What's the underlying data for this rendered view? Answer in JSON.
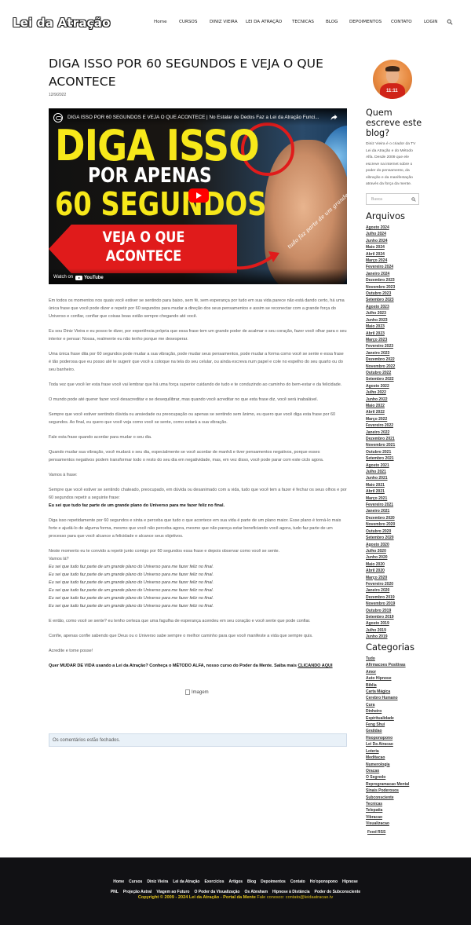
{
  "header": {
    "logo": "Lei da Atração",
    "nav": [
      "Home",
      "CURSOS",
      "DINIZ VIEIRA",
      "LEI DA ATRAÇÃO",
      "TECNICAS",
      "BLOG",
      "DEPOIMENTOS",
      "CONTATO",
      "LOGIN"
    ]
  },
  "post": {
    "title": "DIGA ISSO POR 60 SEGUNDOS E VEJA O QUE ACONTECE",
    "date": "12/9/2022"
  },
  "video": {
    "title": "DIGA ISSO POR 60 SEGUNDOS E VEJA O QUE ACONTECE | No Estalar de Dedos Faz a Lei da Atração Funci...",
    "line1": "DIGA ISSO",
    "line2": "POR APENAS",
    "line3": "60 SEGUNDOS",
    "banner": "VEJA O QUE ACONTECE",
    "hand_text": "tudo faz parte de um grande plano",
    "watch_on": "Watch on",
    "youtube": "YouTube"
  },
  "article": {
    "p1": "Em todos os momentos nos quais você estiver se sentindo para baixo, sem fé, sem esperança por tudo em sua vida parece não está dando certo, há uma única frase que você pode dizer e repetir por 60 segundos para mudar a direção dos seus pensamentos e assim se reconectar com a grande força do Universo e confiar, confiar que coisas boas estão sempre chegando até você.",
    "p2": "Eu sou Diniz Vieira e eu posso te dizer, por experiência própria que essa frase tem um grande poder de acalmar o seu coração, fazer você olhar para o seu interior e pensar: Nossa, realmente eu não tenho porque me desesperar.",
    "p3": "Uma única frase dita por 60 segundos pode mudar a sua vibração, pode mudar seus pensamentos, pode mudar a forma como você se sente e essa frase é tão poderosa que eu posso até te sugerir que você a coloque na tela do seu celular, ou ainda escreva num papel e cole no espelho do seu quarto ou do seu banheiro.",
    "p4": "Toda vez que você ler esta frase você vai lembrar que há uma força superior cuidando de tudo e te conduzindo ao caminho do bem-estar e da felicidade.",
    "p5": "O mundo pode até querer fazer você desacreditar e se desequilibrar, mas quando você acreditar no que esta frase diz, você será inabalável.",
    "p6": "Sempre que você estiver sentindo dúvida ou ansiedade ou preocupação ou apenas se sentindo sem ânimo, eu quero que você diga esta frase por 60 segundos. Ao final, eu quero que você veja como você se sente, como estará a sua vibração.",
    "p7": "Fale esta frase quando acordar para mudar o seu dia.",
    "p8": "Quando mudar sua vibração, você mudará o seu dia, especialmente se você acordar de manhã e tiver pensamentos negativos, porque esses pensamentos negativos podem transformar todo o resto do seu dia em negatividade, mas, em vez disso, você pode parar com este ciclo agora.",
    "p9": "Vamos à frase:",
    "p10": "Sempre que você estiver se sentindo chateado, preocupado, em dúvida ou desanimado com a vida, tudo que você tem a fazer é fechar os seus olhos e por 60 segundos repetir a seguinte frase:",
    "phrase": "Eu sei que tudo faz parte de um grande plano do Universo para me fazer feliz no final.",
    "p11": "Diga isso repetidamente por 60 segundos e sinta e perceba que tudo o que acontece em sua vida é parte de um plano maior. Esse plano é torná-lo mais forte e ajudá-lo de alguma forma, mesmo que você não perceba agora, mesmo que não pareça estar beneficiando você agora, tudo faz parte de um processo para que você alcance a felicidade e alcance seus objetivos.",
    "p12a": "Neste momento eu te convido a repetir junto comigo por 60 segundos essa frase e depois observar como você se sente.",
    "p12b": "Vamos lá?",
    "repeat": [
      "Eu sei que tudo faz parte de um grande plano do Universo para me fazer feliz no final.",
      "Eu sei que tudo faz parte de um grande plano do Universo para me fazer feliz no final.",
      "Eu sei que tudo faz parte de um grande plano do Universo para me fazer feliz no final.",
      "Eu sei que tudo faz parte de um grande plano do Universo para me fazer feliz no final.",
      "Eu sei que tudo faz parte de um grande plano do Universo para me fazer feliz no final.",
      "Eu sei que tudo faz parte de um grande plano do Universo para me fazer feliz no final."
    ],
    "p13": "E então, como você se sente? eu tenho certeza que uma fagulha de esperança acendeu em seu coração e você sente que pode confiar.",
    "p14": "Confie, apenas confie sabendo que Deus ou o Universo sabe sempre o melhor caminho para que você manifeste a vida que sempre quis.",
    "p15": "Acredite e tome posse!",
    "cta": "Quer MUDAR DE VIDA usando a Lei da Atração? Conheça o MÉTODO ALFA, nosso curso do Poder da Mente. Saiba mais ",
    "cta_link": "CLICANDO AQUI",
    "image_alt": "Imagem"
  },
  "comments_closed": "Os comentários estão fechados.",
  "sidebar": {
    "who_title": "Quem escreve este blog?",
    "bio": "Diniz Vieira é o criador da TV Lei da Atração e do Método Alfa. Desde 2009 que ele escreve na internet sobre o poder do pensamento, da vibração e da manifestação através da força da mente.",
    "search_placeholder": "Busca",
    "archives_title": "Arquivos",
    "archives": [
      "Agosto 2024",
      "Julho 2024",
      "Junho 2024",
      "Maio 2024",
      "Abril 2024",
      "Março 2024",
      "Fevereiro 2024",
      "Janeiro 2024",
      "Dezembro 2023",
      "Novembro 2023",
      "Outubro 2023",
      "Setembro 2023",
      "Agosto 2023",
      "Julho 2023",
      "Junho 2023",
      "Maio 2023",
      "Abril 2023",
      "Março 2023",
      "Fevereiro 2023",
      "Janeiro 2023",
      "Dezembro 2022",
      "Novembro 2022",
      "Outubro 2022",
      "Setembro 2022",
      "Agosto 2022",
      "Julho 2022",
      "Junho 2022",
      "Maio 2022",
      "Abril 2022",
      "Março 2022",
      "Fevereiro 2022",
      "Janeiro 2022",
      "Dezembro 2021",
      "Novembro 2021",
      "Outubro 2021",
      "Setembro 2021",
      "Agosto 2021",
      "Julho 2021",
      "Junho 2021",
      "Maio 2021",
      "Abril 2021",
      "Março 2021",
      "Fevereiro 2021",
      "Janeiro 2021",
      "Dezembro 2020",
      "Novembro 2020",
      "Outubro 2020",
      "Setembro 2020",
      "Agosto 2020",
      "Julho 2020",
      "Junho 2020",
      "Maio 2020",
      "Abril 2020",
      "Março 2020",
      "Fevereiro 2020",
      "Janeiro 2020",
      "Dezembro 2019",
      "Novembro 2019",
      "Outubro 2019",
      "Setembro 2019",
      "Agosto 2019",
      "Julho 2019",
      "Junho 2019"
    ],
    "categories_title": "Categorias",
    "categories": [
      "Tudo",
      "Afirmacoes Positivas",
      "Amor",
      "Auto Hipnose",
      "Bíblia",
      "Carta Mágica",
      "Cerebro Humano",
      "Cura",
      "Dinheiro",
      "Espiritualidade",
      "Feng Shui",
      "Gratidao",
      "Hooponopono",
      "Lei Da Atracao",
      "Loteria",
      "Meditacao",
      "Numerologia",
      "Oracao",
      "O Segredo",
      "Reprogramacao Mental",
      "Sinais Poderosos",
      "Subconsciente",
      "Tecnicas",
      "Telepatia",
      "Vibracao",
      "Visualizacao"
    ],
    "feed": "Feed RSS"
  },
  "footer": {
    "links": [
      "Home",
      "Cursos",
      "Diniz Vieira",
      "Lei da Atração",
      "Exercícios",
      "Artigos",
      "Blog",
      "Depoimentos",
      "Contato",
      "Ho'oponopono",
      "Hipnose",
      "PNL",
      "Projeção Astral",
      "Viagem ao Futuro",
      "O Poder da Visualização",
      "Os Abraham",
      "Hipnose à Distância",
      "Poder do Subconsciente"
    ],
    "copyright": "Copyright © 2009 - 2024 Lei da Atração - Portal da Mente",
    "contact": "Fale conosco: contato@leidaatracao.tv"
  }
}
